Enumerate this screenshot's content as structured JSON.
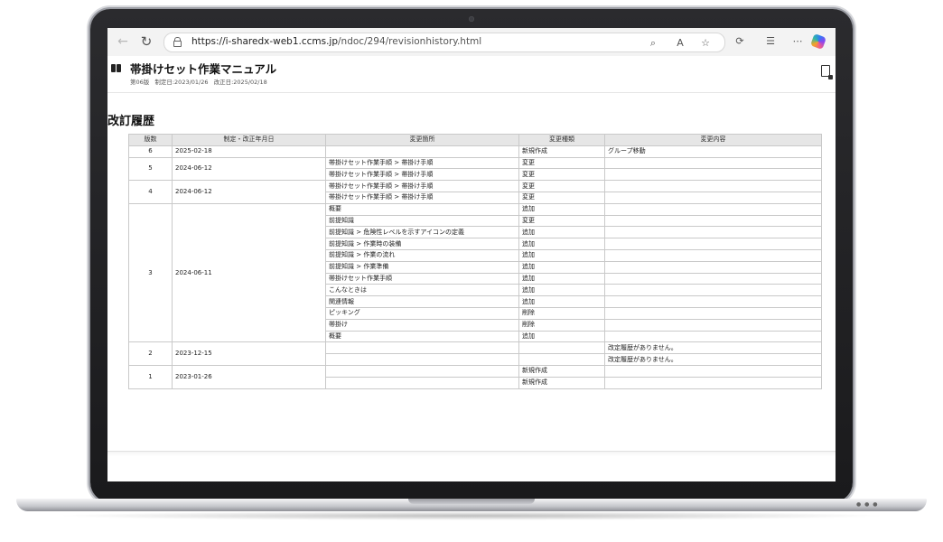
{
  "browser": {
    "url_host": "https://i-sharedx-web1.ccms.jp",
    "url_path": "/ndoc/294/revisionhistory.html",
    "icons": [
      "back-icon",
      "reload-icon",
      "lock-icon",
      "zoom-icon",
      "read-aloud-icon",
      "favorite-icon",
      "extensions-icon",
      "favorites-list-icon",
      "more-icon",
      "copilot-icon"
    ]
  },
  "doc": {
    "title": "帯掛けセット作業マニュアル",
    "edition": "第06版",
    "created": "制定日:2023/01/26",
    "revised": "改正日:2025/02/18"
  },
  "section_title": "改訂履歴",
  "table": {
    "headers": [
      "版数",
      "制定・改正年月日",
      "変更箇所",
      "変更種類",
      "変更内容"
    ],
    "groups": [
      {
        "version": "6",
        "date": "2025-02-18",
        "rows": [
          {
            "location": "",
            "type": "新規作成",
            "content": "グループ移動"
          }
        ]
      },
      {
        "version": "5",
        "date": "2024-06-12",
        "rows": [
          {
            "location": "帯掛けセット作業手順 > 帯掛け手順",
            "type": "変更",
            "content": ""
          },
          {
            "location": "帯掛けセット作業手順 > 帯掛け手順",
            "type": "変更",
            "content": ""
          }
        ]
      },
      {
        "version": "4",
        "date": "2024-06-12",
        "rows": [
          {
            "location": "帯掛けセット作業手順 > 帯掛け手順",
            "type": "変更",
            "content": ""
          },
          {
            "location": "帯掛けセット作業手順 > 帯掛け手順",
            "type": "変更",
            "content": ""
          }
        ]
      },
      {
        "version": "3",
        "date": "2024-06-11",
        "rows": [
          {
            "location": "概要",
            "type": "追加",
            "content": ""
          },
          {
            "location": "前提知識",
            "type": "変更",
            "content": ""
          },
          {
            "location": "前提知識 > 危険性レベルを示すアイコンの定義",
            "type": "追加",
            "content": ""
          },
          {
            "location": "前提知識 > 作業時の装備",
            "type": "追加",
            "content": ""
          },
          {
            "location": "前提知識 > 作業の流れ",
            "type": "追加",
            "content": ""
          },
          {
            "location": "前提知識 > 作業準備",
            "type": "追加",
            "content": ""
          },
          {
            "location": "帯掛けセット作業手順",
            "type": "追加",
            "content": ""
          },
          {
            "location": "こんなときは",
            "type": "追加",
            "content": ""
          },
          {
            "location": "関連情報",
            "type": "追加",
            "content": ""
          },
          {
            "location": "ピッキング",
            "type": "削除",
            "content": ""
          },
          {
            "location": "帯掛け",
            "type": "削除",
            "content": ""
          },
          {
            "location": "概要",
            "type": "追加",
            "content": ""
          }
        ]
      },
      {
        "version": "2",
        "date": "2023-12-15",
        "rows": [
          {
            "location": "",
            "type": "",
            "content": "改定履歴がありません。"
          },
          {
            "location": "",
            "type": "",
            "content": "改定履歴がありません。"
          }
        ]
      },
      {
        "version": "1",
        "date": "2023-01-26",
        "rows": [
          {
            "location": "",
            "type": "新規作成",
            "content": ""
          },
          {
            "location": "",
            "type": "新規作成",
            "content": ""
          }
        ]
      }
    ]
  }
}
